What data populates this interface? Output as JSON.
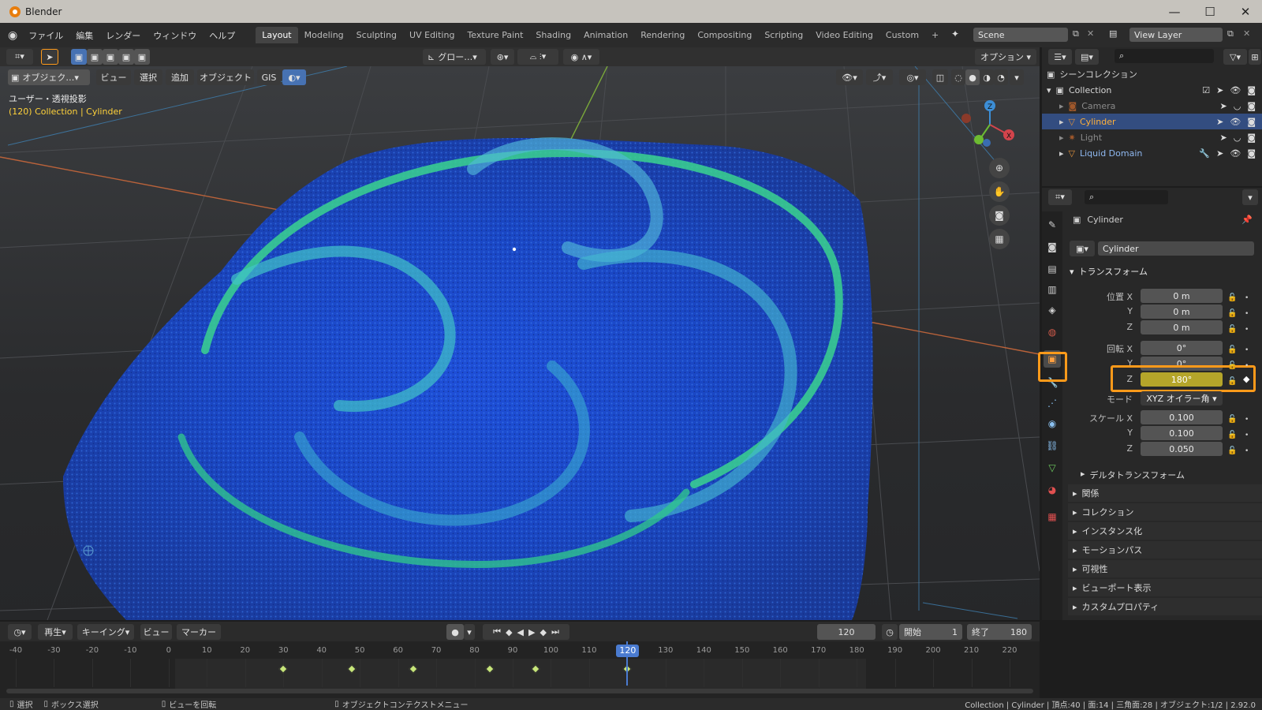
{
  "window": {
    "title": "Blender",
    "minimize": "—",
    "maximize": "☐",
    "close": "✕"
  },
  "menu": [
    "ファイル",
    "編集",
    "レンダー",
    "ウィンドウ",
    "ヘルプ"
  ],
  "workspaces": [
    "Layout",
    "Modeling",
    "Sculpting",
    "UV Editing",
    "Texture Paint",
    "Shading",
    "Animation",
    "Rendering",
    "Compositing",
    "Scripting",
    "Video Editing",
    "Custom"
  ],
  "workspace_add": "+",
  "scene": "Scene",
  "view_layer": "View Layer",
  "tool_header": {
    "transform_orientation": "グロー…",
    "options": "オプション"
  },
  "viewport_header": {
    "mode": "オブジェク…",
    "items": [
      "ビュー",
      "選択",
      "追加",
      "オブジェクト",
      "GIS"
    ]
  },
  "viewport": {
    "view_name": "ユーザー・透視投影",
    "context": "(120) Collection | Cylinder"
  },
  "outliner": {
    "root": "シーンコレクション",
    "collection": "Collection",
    "items": [
      {
        "name": "Camera",
        "dim": true
      },
      {
        "name": "Cylinder",
        "dim": false,
        "selected": true
      },
      {
        "name": "Light",
        "dim": true
      },
      {
        "name": "Liquid Domain",
        "dim": false
      }
    ]
  },
  "properties": {
    "object_name": "Cylinder",
    "object_field": "Cylinder",
    "transform_title": "トランスフォーム",
    "location_label": "位置 X",
    "rotation_label": "回転 X",
    "scale_label": "スケール X",
    "axis_y": "Y",
    "axis_z": "Z",
    "location": [
      "0 m",
      "0 m",
      "0 m"
    ],
    "rotation": [
      "0°",
      "0°",
      "180°"
    ],
    "mode_label": "モード",
    "mode_value": "XYZ オイラー角",
    "scale": [
      "0.100",
      "0.100",
      "0.050"
    ],
    "delta": "デルタトランスフォーム",
    "panels": [
      "関係",
      "コレクション",
      "インスタンス化",
      "モーションパス",
      "可視性",
      "ビューポート表示",
      "カスタムプロパティ"
    ]
  },
  "timeline": {
    "playback": "再生",
    "keying": "キーイング",
    "view": "ビュー",
    "marker": "マーカー",
    "current_frame": "120",
    "start_label": "開始",
    "start": "1",
    "end_label": "終了",
    "end": "180",
    "ticks": [
      "-40",
      "-30",
      "-20",
      "-10",
      "0",
      "10",
      "20",
      "30",
      "40",
      "50",
      "60",
      "70",
      "80",
      "90",
      "100",
      "110",
      "120",
      "130",
      "140",
      "150",
      "160",
      "170",
      "180",
      "190",
      "200",
      "210",
      "220"
    ],
    "keyframes": [
      30,
      48,
      64,
      84,
      96,
      120
    ]
  },
  "statusbar": {
    "select": "選択",
    "box_select": "ボックス選択",
    "rotate_view": "ビューを回転",
    "context_menu": "オブジェクトコンテクストメニュー",
    "stats": "Collection | Cylinder | 頂点:40 | 面:14 | 三角面:28 | オブジェクト:1/2 | 2.92.0"
  },
  "colors": {
    "accent": "#4772b3",
    "highlight": "#ff9a1a",
    "animated_field": "#b5a52a",
    "keyframe": "#c7e67a"
  }
}
